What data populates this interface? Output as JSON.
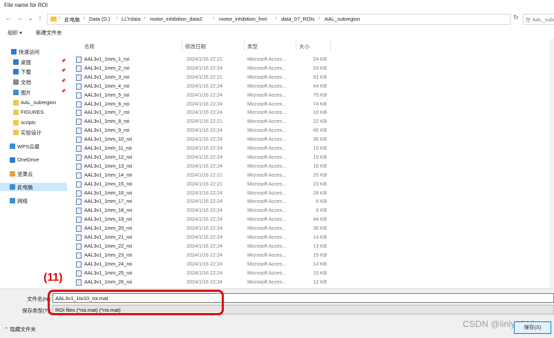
{
  "window": {
    "title": "File name for ROI"
  },
  "nav": {
    "back": "←",
    "forward": "→",
    "recent": "⌄",
    "up": "↑",
    "path": [
      "此电脑",
      "Data (D:)",
      "LLYdata",
      "motor_inhibition_data2",
      "motor_inhibition_fmri",
      "data_07_ROIs",
      "AAL_subregion"
    ],
    "refresh": "↻",
    "search_placeholder": "在 AAL_subre"
  },
  "toolbar": {
    "organize": "组织 ▾",
    "new_folder": "新建文件夹"
  },
  "sidebar": {
    "items": [
      {
        "label": "快速访问",
        "icon": "star-icon",
        "color": "#2f7ad6"
      },
      {
        "label": "桌面",
        "icon": "desktop-icon",
        "color": "#2f7ad6",
        "pinned": true
      },
      {
        "label": "下载",
        "icon": "download-icon",
        "color": "#2f7ad6",
        "pinned": true
      },
      {
        "label": "文档",
        "icon": "document-icon",
        "color": "#8a8a8a",
        "pinned": true
      },
      {
        "label": "图片",
        "icon": "pictures-icon",
        "color": "#3a8fd8",
        "pinned": true
      },
      {
        "label": "AAL_subregion",
        "icon": "folder-icon",
        "color": "#f3c44f"
      },
      {
        "label": "FIGURES",
        "icon": "folder-icon",
        "color": "#f3c44f"
      },
      {
        "label": "scripts",
        "icon": "folder-icon",
        "color": "#f3c44f"
      },
      {
        "label": "实验设计",
        "icon": "folder-icon",
        "color": "#f3c44f"
      },
      {
        "label": "WPS云盘",
        "icon": "cloud-icon",
        "color": "#3a8fd8"
      },
      {
        "label": "OneDrive",
        "icon": "onedrive-icon",
        "color": "#2f7ad6"
      },
      {
        "label": "坚果云",
        "icon": "nutstore-icon",
        "color": "#e6a23c"
      },
      {
        "label": "此电脑",
        "icon": "computer-icon",
        "color": "#3a8fd8",
        "selected": true
      },
      {
        "label": "网络",
        "icon": "network-icon",
        "color": "#3a8fd8"
      }
    ]
  },
  "file_list": {
    "columns": [
      "名称",
      "修改日期",
      "类型",
      "大小"
    ],
    "rows": [
      {
        "name": "AAL3v1_1mm_1_roi",
        "date": "2024/1/16 22:21",
        "type": "Microsoft Acces...",
        "size": "24 KB"
      },
      {
        "name": "AAL3v1_1mm_2_roi",
        "date": "2024/1/16 22:24",
        "type": "Microsoft Acces...",
        "size": "24 KB"
      },
      {
        "name": "AAL3v1_1mm_3_roi",
        "date": "2024/1/16 22:21",
        "type": "Microsoft Acces...",
        "size": "61 KB"
      },
      {
        "name": "AAL3v1_1mm_4_roi",
        "date": "2024/1/16 22:24",
        "type": "Microsoft Acces...",
        "size": "64 KB"
      },
      {
        "name": "AAL3v1_1mm_5_roi",
        "date": "2024/1/16 22:24",
        "type": "Microsoft Acces...",
        "size": "75 KB"
      },
      {
        "name": "AAL3v1_1mm_6_roi",
        "date": "2024/1/16 22:24",
        "type": "Microsoft Acces...",
        "size": "74 KB"
      },
      {
        "name": "AAL3v1_1mm_7_roi",
        "date": "2024/1/16 22:24",
        "type": "Microsoft Acces...",
        "size": "10 KB"
      },
      {
        "name": "AAL3v1_1mm_8_roi",
        "date": "2024/1/16 22:21",
        "type": "Microsoft Acces...",
        "size": "22 KB"
      },
      {
        "name": "AAL3v1_1mm_9_roi",
        "date": "2024/1/16 22:24",
        "type": "Microsoft Acces...",
        "size": "40 KB"
      },
      {
        "name": "AAL3v1_1mm_10_roi",
        "date": "2024/1/16 22:24",
        "type": "Microsoft Acces...",
        "size": "35 KB"
      },
      {
        "name": "AAL3v1_1mm_11_roi",
        "date": "2024/1/16 22:24",
        "type": "Microsoft Acces...",
        "size": "10 KB"
      },
      {
        "name": "AAL3v1_1mm_12_roi",
        "date": "2024/1/16 22:24",
        "type": "Microsoft Acces...",
        "size": "15 KB"
      },
      {
        "name": "AAL3v1_1mm_13_roi",
        "date": "2024/1/16 22:24",
        "type": "Microsoft Acces...",
        "size": "16 KB"
      },
      {
        "name": "AAL3v1_1mm_14_roi",
        "date": "2024/1/16 22:21",
        "type": "Microsoft Acces...",
        "size": "20 KB"
      },
      {
        "name": "AAL3v1_1mm_15_roi",
        "date": "2024/1/16 22:21",
        "type": "Microsoft Acces...",
        "size": "23 KB"
      },
      {
        "name": "AAL3v1_1mm_16_roi",
        "date": "2024/1/16 22:24",
        "type": "Microsoft Acces...",
        "size": "28 KB"
      },
      {
        "name": "AAL3v1_1mm_17_roi",
        "date": "2024/1/16 22:24",
        "type": "Microsoft Acces...",
        "size": "6 KB"
      },
      {
        "name": "AAL3v1_1mm_18_roi",
        "date": "2024/1/16 22:24",
        "type": "Microsoft Acces...",
        "size": "6 KB"
      },
      {
        "name": "AAL3v1_1mm_19_roi",
        "date": "2024/1/16 22:24",
        "type": "Microsoft Acces...",
        "size": "44 KB"
      },
      {
        "name": "AAL3v1_1mm_20_roi",
        "date": "2024/1/16 22:24",
        "type": "Microsoft Acces...",
        "size": "36 KB"
      },
      {
        "name": "AAL3v1_1mm_21_roi",
        "date": "2024/1/16 22:24",
        "type": "Microsoft Acces...",
        "size": "14 KB"
      },
      {
        "name": "AAL3v1_1mm_22_roi",
        "date": "2024/1/16 22:24",
        "type": "Microsoft Acces...",
        "size": "13 KB"
      },
      {
        "name": "AAL3v1_1mm_23_roi",
        "date": "2024/1/16 22:24",
        "type": "Microsoft Acces...",
        "size": "15 KB"
      },
      {
        "name": "AAL3v1_1mm_24_roi",
        "date": "2024/1/16 22:24",
        "type": "Microsoft Acces...",
        "size": "14 KB"
      },
      {
        "name": "AAL3v1_1mm_25_roi",
        "date": "2024/1/16 22:24",
        "type": "Microsoft Acces...",
        "size": "15 KB"
      },
      {
        "name": "AAL3v1_1mm_26_roi",
        "date": "2024/1/16 22:24",
        "type": "Microsoft Acces...",
        "size": "12 KB"
      }
    ]
  },
  "bottom": {
    "filename_label": "文件名(N):",
    "filename_value": "AAL3v1_1to10_roi.mat",
    "filetype_label": "保存类型(T):",
    "filetype_value": "ROI files (*roi.mat) (*roi.mat)",
    "hide_folders": "⌃ 隐藏文件夹",
    "save_button": "保存(S)"
  },
  "annotation": {
    "label": "(11)",
    "color": "#e00000"
  },
  "watermark": "CSDN @linly1219"
}
